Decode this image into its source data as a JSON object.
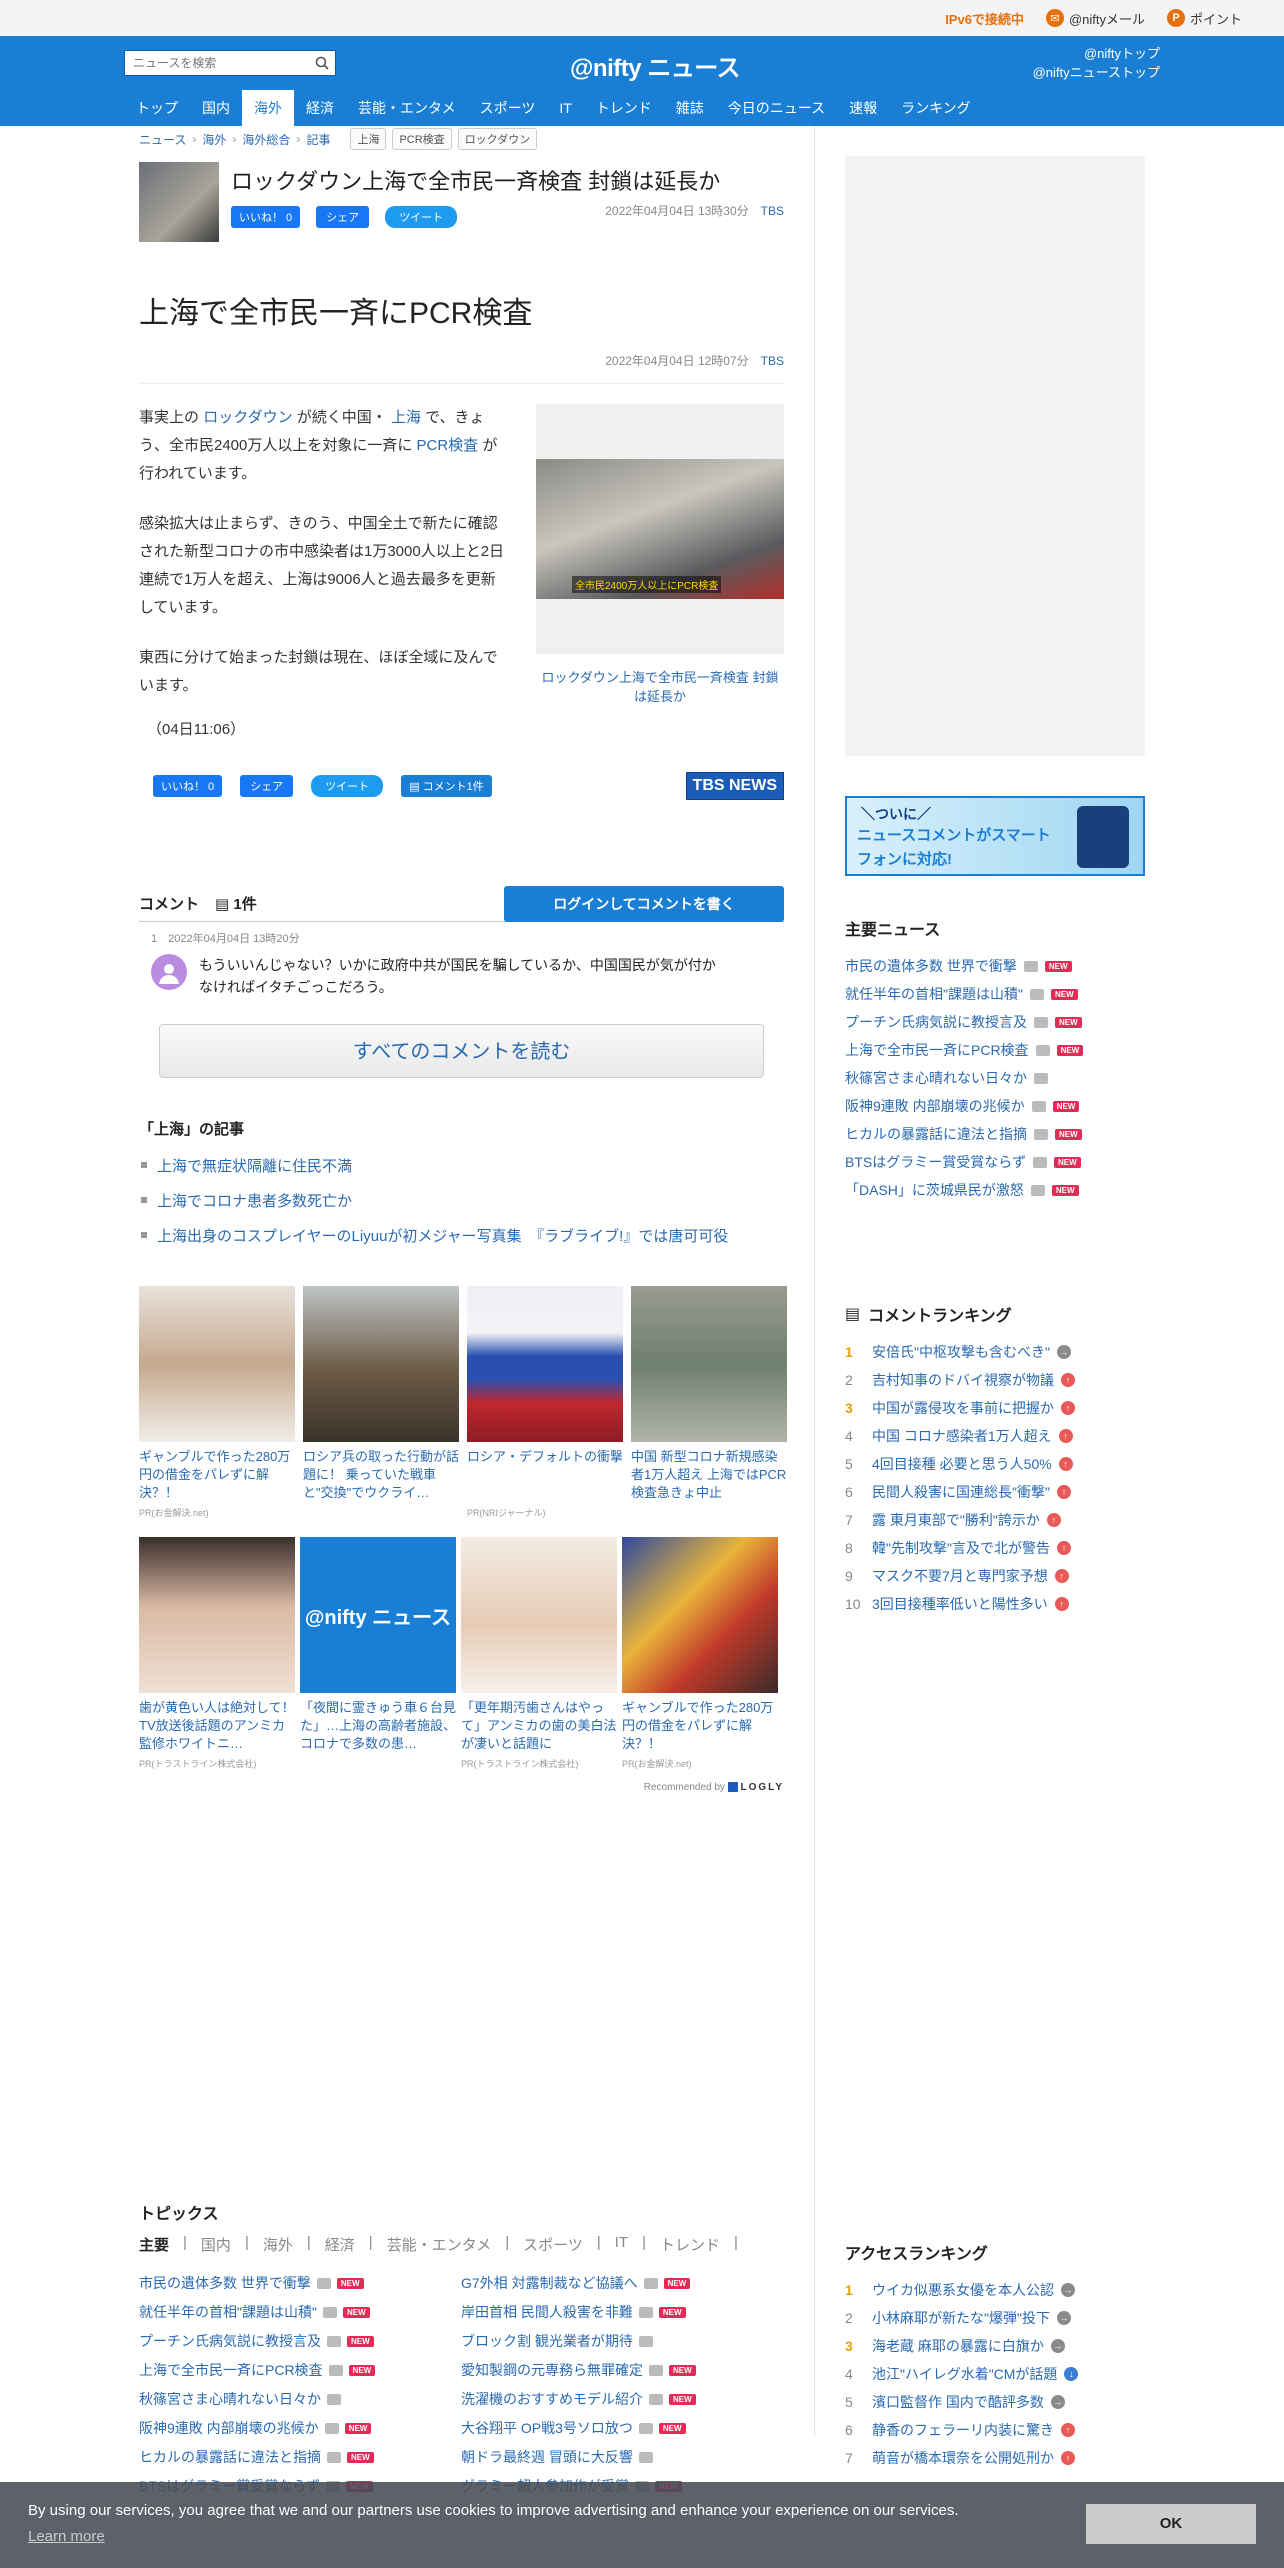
{
  "util": {
    "ipv6": "IPv6で接続中",
    "mail": "@niftyメール",
    "point": "ポイント"
  },
  "header": {
    "search_placeholder": "ニュースを検索",
    "logo": "@nifty ニュース",
    "link1": "@niftyトップ",
    "link2": "@niftyニューストップ",
    "nav": [
      "トップ",
      "国内",
      "海外",
      "経済",
      "芸能・エンタメ",
      "スポーツ",
      "IT",
      "トレンド",
      "雑誌",
      "今日のニュース",
      "速報",
      "ランキング"
    ]
  },
  "breadcrumb": [
    "ニュース",
    "海外",
    "海外総合",
    "記事"
  ],
  "tags": [
    "上海",
    "PCR検査",
    "ロックダウン"
  ],
  "headline": {
    "title": "ロックダウン上海で全市民一斉検査 封鎖は延長か",
    "like": "いいね！ 0",
    "share": "シェア",
    "tweet": "ツイート",
    "date": "2022年04月04日 13時30分",
    "source": "TBS"
  },
  "article": {
    "title": "上海で全市民一斉にPCR検査",
    "date": "2022年04月04日 12時07分",
    "source": "TBS",
    "p1_a": "事実上の",
    "p1_link1": "ロックダウン",
    "p1_b": "が続く中国・",
    "p1_link2": "上海",
    "p1_c": "で、きょう、全市民2400万人以上を対象に一斉に",
    "p1_link3": "PCR検査",
    "p1_d": "が行われています。",
    "p2": "感染拡大は止まらず、きのう、中国全土で新たに確認された新型コロナの市中感染者は1万3000人以上と2日連続で1万人を超え、上海は9006人と過去最多を更新しています。",
    "p3": "東西に分けて始まった封鎖は現在、ほぼ全域に及んでいます。",
    "time": "（04日11:06）",
    "photo_caption": "ロックダウン上海で全市民一斉検査 封鎖は延長か",
    "photo_overlay": "全市民2400万人以上にPCR検査",
    "comment_btn": "コメント1件",
    "tbs_logo": "TBS NEWS"
  },
  "comments": {
    "label": "コメント",
    "count": "1件",
    "login": "ログインしてコメントを書く",
    "num": "1",
    "date": "2022年04月04日 13時20分",
    "text": "もういいんじゃない？いかに政府中共が国民を騙しているか、中国国民が気が付かなければイタチごっこだろう。",
    "read_all": "すべてのコメントを読む"
  },
  "related": {
    "title": "「上海」の記事",
    "items": [
      "上海で無症状隔離に住民不満",
      "上海でコロナ患者多数死亡か",
      "上海出身のコスプレイヤーのLiyuuが初メジャー写真集　『ラブライブ!』では唐可可役"
    ]
  },
  "cards1": [
    {
      "t": "ギャンブルで作った280万円の借金をパレずに解決？！",
      "pr": "PR(お金解決.net)"
    },
    {
      "t": "ロシア兵の取った行動が話題に！ 乗っていた戦車と\"交換\"でウクライ…",
      "pr": ""
    },
    {
      "t": "ロシア・デフォルトの衝撃",
      "pr": "PR(NRIジャーナル)"
    },
    {
      "t": "中国 新型コロナ新規感染者1万人超え 上海ではPCR検査急きょ中止",
      "pr": ""
    }
  ],
  "cards2": [
    {
      "t": "歯が黄色い人は絶対して！TV放送後話題のアンミカ監修ホワイトニ…",
      "pr": "PR(トラストライン株式会社)"
    },
    {
      "t": "「夜間に霊きゅう車６台見た」…上海の高齢者施設、コロナで多数の患…",
      "pr": ""
    },
    {
      "t": "「更年期汚歯さんはやって」アンミカの歯の美白法が凄いと話題に",
      "pr": "PR(トラストライン株式会社)"
    },
    {
      "t": "ギャンブルで作った280万円の借金をパレずに解決？！",
      "pr": "PR(お金解決.net)"
    }
  ],
  "recommend": {
    "label": "Recommended by",
    "brand": "LOGLY"
  },
  "topics": {
    "title": "トピックス",
    "tabs": [
      "主要",
      "国内",
      "海外",
      "経済",
      "芸能・エンタメ",
      "スポーツ",
      "IT",
      "トレンド"
    ],
    "left": [
      {
        "t": "市民の遺体多数 世界で衝撃",
        "new": true
      },
      {
        "t": "就任半年の首相\"課題は山積\"",
        "new": true
      },
      {
        "t": "プーチン氏病気説に教授言及",
        "new": true
      },
      {
        "t": "上海で全市民一斉にPCR検査",
        "new": true
      },
      {
        "t": "秋篠宮さま心晴れない日々か",
        "new": false
      },
      {
        "t": "阪神9連敗 内部崩壊の兆候か",
        "new": true
      },
      {
        "t": "ヒカルの暴露話に違法と指摘",
        "new": true
      },
      {
        "t": "BTSはグラミー賞受賞ならず",
        "new": true
      }
    ],
    "right": [
      {
        "t": "G7外相 対露制裁など協議へ",
        "new": true
      },
      {
        "t": "岸田首相 民間人殺害を非難",
        "new": true
      },
      {
        "t": "ブロック割 観光業者が期待",
        "new": false
      },
      {
        "t": "愛知製鋼の元専務ら無罪確定",
        "new": true
      },
      {
        "t": "洗濯機のおすすめモデル紹介",
        "new": true
      },
      {
        "t": "大谷翔平 OP戦3号ソロ放つ",
        "new": true
      },
      {
        "t": "朝ドラ最終週 冒頭に大反響",
        "new": false
      },
      {
        "t": "グラミー超人参加作が受賞",
        "new": true
      }
    ]
  },
  "sidebar": {
    "banner_l1": "＼ついに／",
    "banner_l2": "ニュースコメントがスマートフォンに対応!",
    "main_title": "主要ニュース",
    "main_news": [
      {
        "t": "市民の遺体多数 世界で衝撃",
        "new": true
      },
      {
        "t": "就任半年の首相\"課題は山積\"",
        "new": true
      },
      {
        "t": "プーチン氏病気説に教授言及",
        "new": true
      },
      {
        "t": "上海で全市民一斉にPCR検査",
        "new": true
      },
      {
        "t": "秋篠宮さま心晴れない日々か",
        "new": false
      },
      {
        "t": "阪神9連敗 内部崩壊の兆候か",
        "new": true
      },
      {
        "t": "ヒカルの暴露話に違法と指摘",
        "new": true
      },
      {
        "t": "BTSはグラミー賞受賞ならず",
        "new": true
      },
      {
        "t": "「DASH」に茨城県民が激怒",
        "new": true
      }
    ],
    "comment_title": "コメントランキング",
    "comment_rank": [
      {
        "t": "安倍氏\"中枢攻撃も含むべき\"",
        "dir": "same"
      },
      {
        "t": "吉村知事のドバイ視察が物議",
        "dir": "up"
      },
      {
        "t": "中国が露侵攻を事前に把握か",
        "dir": "up"
      },
      {
        "t": "中国 コロナ感染者1万人超え",
        "dir": "up"
      },
      {
        "t": "4回目接種 必要と思う人50%",
        "dir": "up"
      },
      {
        "t": "民間人殺害に国連総長\"衝撃\"",
        "dir": "up"
      },
      {
        "t": "露 東月東部で\"勝利\"誇示か",
        "dir": "up"
      },
      {
        "t": "韓\"先制攻撃\"言及で北が警告",
        "dir": "up"
      },
      {
        "t": "マスク不要7月と専門家予想",
        "dir": "up"
      },
      {
        "t": "3回目接種率低いと陽性多い",
        "dir": "up"
      }
    ],
    "access_title": "アクセスランキング",
    "access_rank": [
      {
        "t": "ウイカ似悪系女優を本人公認",
        "dir": "same"
      },
      {
        "t": "小林麻耶が新たな\"爆弾\"投下",
        "dir": "same"
      },
      {
        "t": "海老蔵 麻耶の暴露に白旗か",
        "dir": "same"
      },
      {
        "t": "池江\"ハイレグ水着\"CMが話題",
        "dir": "down"
      },
      {
        "t": "濱口監督作 国内で酷評多数",
        "dir": "same"
      },
      {
        "t": "静香のフェラーリ内装に驚き",
        "dir": "up"
      },
      {
        "t": "萌音が橋本環奈を公開処刑か",
        "dir": "up"
      }
    ]
  },
  "cookie": {
    "msg": "By using our services, you agree that we and our partners use cookies to improve advertising and enhance your experience on our services.",
    "learn": "Learn more",
    "ok": "OK"
  },
  "colors": {
    "brand": "#1a7fd4",
    "new": "#e32b55",
    "rank_gold": "#e8a00a"
  }
}
